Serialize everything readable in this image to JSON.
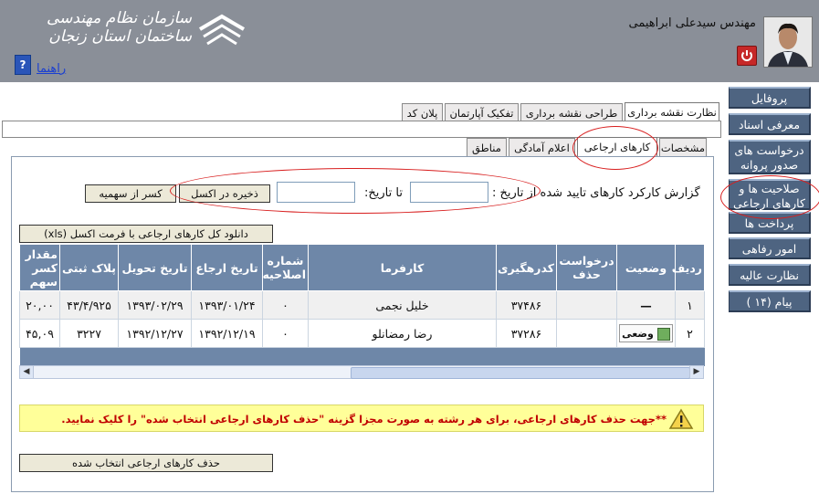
{
  "header": {
    "user_name": "مهندس سیدعلی ابراهیمی",
    "org_title": "سازمان نظام مهندسی ساختمان استان زنجان",
    "help_link": "راهنما"
  },
  "sidebar": {
    "items": [
      {
        "label": "پروفایل"
      },
      {
        "label": "معرفی اسناد"
      },
      {
        "label": "درخواست های صدور پروانه"
      },
      {
        "label": "صلاحیت ها و کارهای ارجاعی"
      },
      {
        "label": "پرداخت ها"
      },
      {
        "label": "امور رفاهی"
      },
      {
        "label": "نظارت عالیه"
      },
      {
        "label": "پیام (۱۴ )"
      }
    ]
  },
  "main_tabs": [
    {
      "label": "نظارت نقشه برداری"
    },
    {
      "label": "طراحی نقشه برداری"
    },
    {
      "label": "تفکیک آپارتمان"
    },
    {
      "label": "پلان کد"
    }
  ],
  "sub_tabs": [
    {
      "label": "مشخصات"
    },
    {
      "label": "کارهای ارجاعی"
    },
    {
      "label": "اعلام آمادگی"
    },
    {
      "label": "مناطق"
    }
  ],
  "report": {
    "label": "گزارش کارکرد کارهای تایید شده از تاریخ :",
    "to_date_label": "تا تاریخ:",
    "from_value": "",
    "to_value": "",
    "save_excel": "ذخیره در اکسل",
    "share_deduction": "کسر از سهمیه"
  },
  "download_all": "دانلود کل کارهای ارجاعی با فرمت اکسل (xls)",
  "table": {
    "headers": [
      "ردیف",
      "وضعیت",
      "درخواست حذف",
      "کدرهگیری",
      "کارفرما",
      "شماره اصلاحیه",
      "تاریخ ارجاع",
      "تاریخ تحویل",
      "پلاک ثبتی",
      "مقدار کسر سهم"
    ],
    "rows": [
      {
        "idx": "۱",
        "status": "—",
        "delete_req": "",
        "tracking": "۳۷۴۸۶",
        "employer": "خلیل نجمی",
        "amend": "۰",
        "ref_date": "۱۳۹۳/۰۱/۲۴",
        "deliver_date": "۱۳۹۳/۰۲/۲۹",
        "plate": "۴۳/۴/۹۲۵",
        "deduct": "۲۰,۰۰"
      },
      {
        "idx": "۲",
        "status": "وضعی",
        "delete_req": "",
        "tracking": "۳۷۲۸۶",
        "employer": "رضا رمضانلو",
        "amend": "۰",
        "ref_date": "۱۳۹۲/۱۲/۱۹",
        "deliver_date": "۱۳۹۲/۱۲/۲۷",
        "plate": "۳۲۲۷",
        "deduct": "۴۵,۰۹"
      }
    ]
  },
  "warning": "**جهت حذف کارهای ارجاعی، برای هر رشته  به صورت مجزا  گزینه \"حذف کارهای ارجاعی انتخاب شده\" را کلیک نمایید.",
  "delete_selected": "حذف کارهای ارجاعی انتخاب شده",
  "colors": {
    "header_bg": "#8a8f98",
    "nav_bg": "#4e6481",
    "table_header_bg": "#6e87a8",
    "warning_bg": "#ffff99",
    "warning_text": "#c00000",
    "annotation": "#d81e1e"
  }
}
